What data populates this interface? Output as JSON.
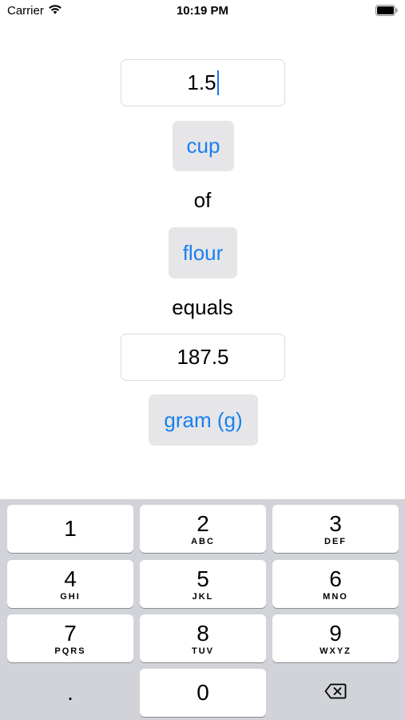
{
  "status_bar": {
    "carrier": "Carrier",
    "time": "10:19 PM",
    "wifi_icon": "wifi-icon",
    "battery_icon": "battery-icon"
  },
  "converter": {
    "input_value": "1.5",
    "from_unit": "cup",
    "of_label": "of",
    "ingredient": "flour",
    "equals_label": "equals",
    "result_value": "187.5",
    "to_unit": "gram (g)"
  },
  "keyboard": {
    "keys": [
      {
        "digit": "1",
        "letters": ""
      },
      {
        "digit": "2",
        "letters": "ABC"
      },
      {
        "digit": "3",
        "letters": "DEF"
      },
      {
        "digit": "4",
        "letters": "GHI"
      },
      {
        "digit": "5",
        "letters": "JKL"
      },
      {
        "digit": "6",
        "letters": "MNO"
      },
      {
        "digit": "7",
        "letters": "PQRS"
      },
      {
        "digit": "8",
        "letters": "TUV"
      },
      {
        "digit": "9",
        "letters": "WXYZ"
      }
    ],
    "decimal": ".",
    "zero": "0",
    "delete_icon": "delete-backspace-icon"
  },
  "colors": {
    "accent": "#1a7ff2",
    "button_bg": "#e6e6e8",
    "keyboard_bg": "#d1d3d9"
  }
}
